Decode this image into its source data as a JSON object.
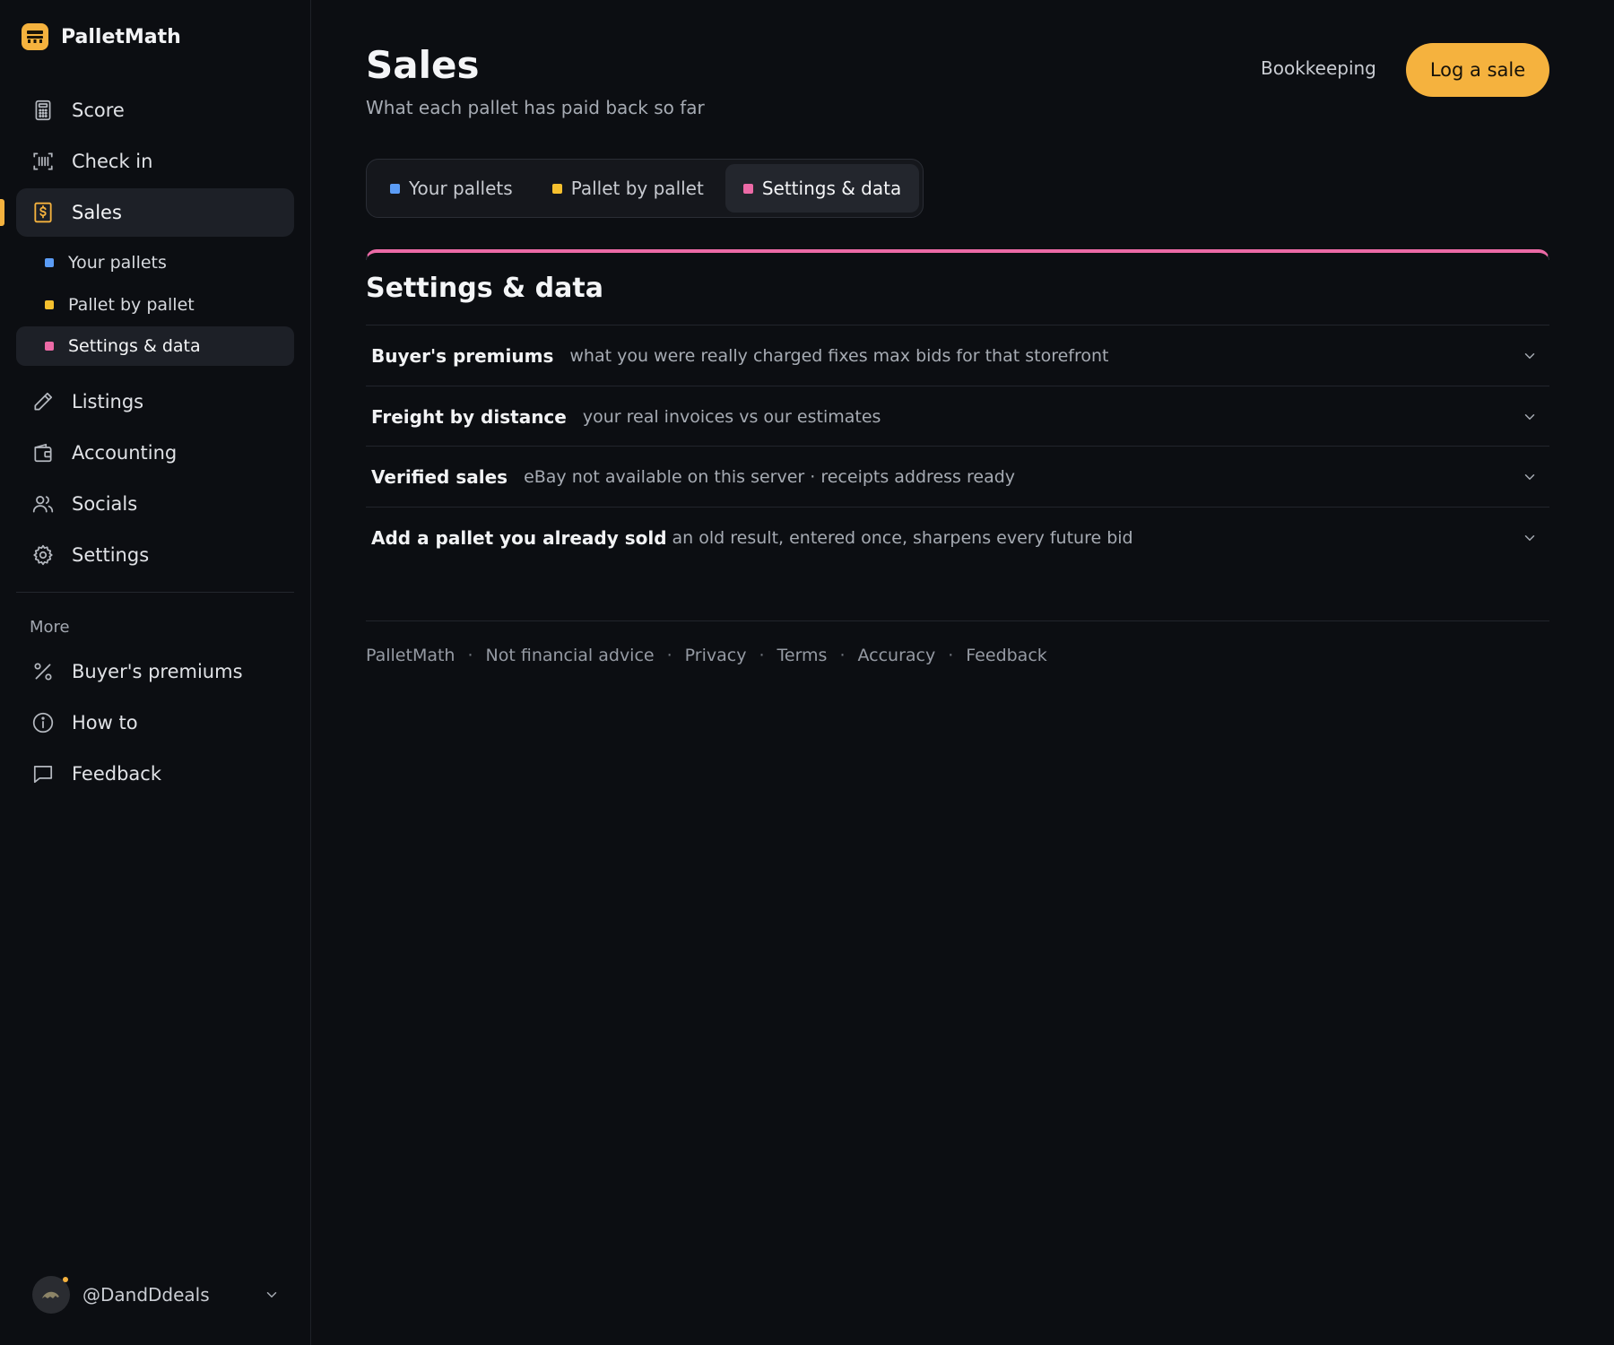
{
  "app": {
    "name": "PalletMath"
  },
  "nav": {
    "score": "Score",
    "check_in": "Check in",
    "sales": "Sales",
    "listings": "Listings",
    "accounting": "Accounting",
    "socials": "Socials",
    "settings": "Settings"
  },
  "sales_sub": {
    "your_pallets": "Your pallets",
    "pallet_by_pallet": "Pallet by pallet",
    "settings_data": "Settings & data"
  },
  "more": {
    "label": "More",
    "buyers_premiums": "Buyer's premiums",
    "how_to": "How to",
    "feedback": "Feedback"
  },
  "user": {
    "handle": "@DandDdeals"
  },
  "header": {
    "title": "Sales",
    "subtitle": "What each pallet has paid back so far",
    "bookkeeping": "Bookkeeping",
    "log_sale": "Log a sale"
  },
  "tabs": {
    "your_pallets": "Your pallets",
    "pallet_by_pallet": "Pallet by pallet",
    "settings_data": "Settings & data"
  },
  "panel": {
    "title": "Settings & data",
    "rows": [
      {
        "title": "Buyer's premiums",
        "desc": "what you were really charged fixes max bids for that storefront"
      },
      {
        "title": "Freight by distance",
        "desc": "your real invoices vs our estimates"
      },
      {
        "title": "Verified sales",
        "desc": "eBay not available on this server · receipts address ready"
      },
      {
        "title": "Add a pallet you already sold",
        "desc": "an old result, entered once, sharpens every future bid"
      }
    ]
  },
  "footer": {
    "brand": "PalletMath",
    "not_financial_advice": "Not financial advice",
    "privacy": "Privacy",
    "terms": "Terms",
    "accuracy": "Accuracy",
    "feedback": "Feedback"
  },
  "colors": {
    "accent": "#f5b23e",
    "blue_dot": "#5b9cf5",
    "yellow_dot": "#f5c02e",
    "pink_dot": "#ec6aa6"
  }
}
